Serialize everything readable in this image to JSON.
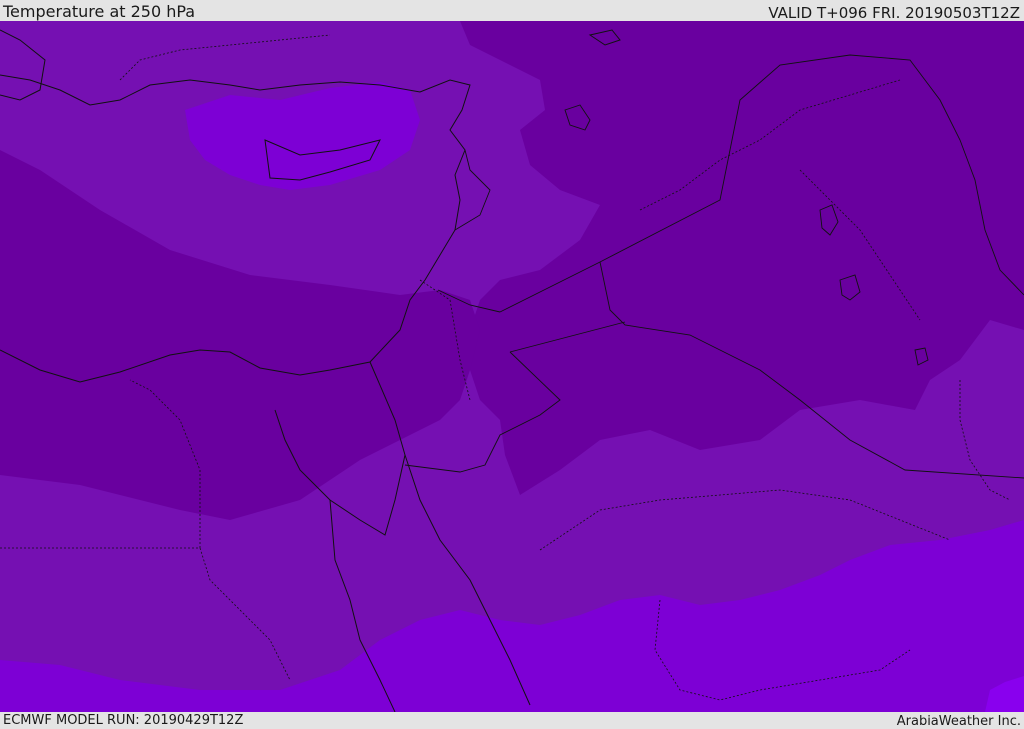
{
  "header": {
    "title": "Temperature at 250 hPa",
    "valid_time": "VALID T+096 FRI. 20190503T12Z"
  },
  "footer": {
    "model_run": "ECMWF MODEL RUN: 20190429T12Z",
    "credit": "ArabiaWeather Inc."
  },
  "map": {
    "shading_colors": {
      "coldest": "#5e0095",
      "cold": "#69009f",
      "mid": "#7510b2",
      "warm": "#7d00d5",
      "warmest": "#8900ee"
    },
    "line_color": "#111111"
  }
}
